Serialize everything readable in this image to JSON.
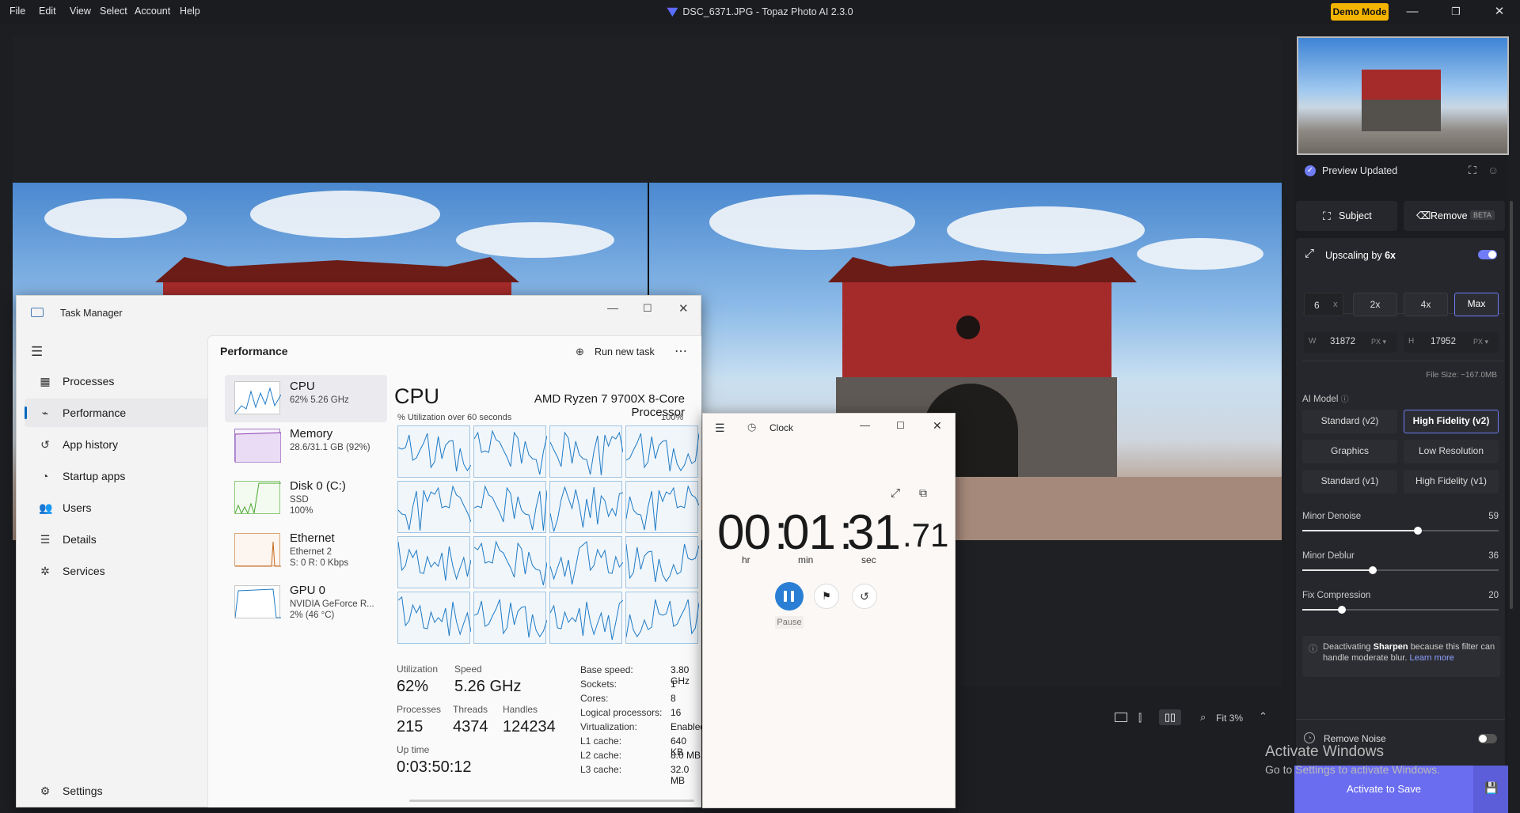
{
  "menu": [
    "File",
    "Edit",
    "View",
    "Select",
    "Account",
    "Help"
  ],
  "app_title": "DSC_6371.JPG - Topaz Photo AI 2.3.0",
  "demo_badge": "Demo Mode",
  "colors": {
    "accent": "#6f7cf5",
    "demo": "#f5b400",
    "tm_accent": "#0067c0",
    "clock_accent": "#2a7fd4"
  },
  "panel": {
    "preview_status": "Preview Updated",
    "subject_btn": "Subject",
    "remove_btn": "Remove",
    "beta": "BETA",
    "upscaling_label": "Upscaling by",
    "upscaling_value": "6x",
    "upscaling_on": true,
    "scale_input": "6",
    "scale_x": "x",
    "scale_opts": [
      "2x",
      "4x",
      "Max"
    ],
    "scale_selected": "Max",
    "w_label": "W",
    "w_value": "31872",
    "h_label": "H",
    "h_value": "17952",
    "unit": "PX",
    "file_size": "File Size: ~167.0MB",
    "ai_model_label": "AI Model",
    "models": [
      "Standard (v2)",
      "High Fidelity (v2)",
      "Graphics",
      "Low Resolution",
      "Standard (v1)",
      "High Fidelity (v1)"
    ],
    "model_selected": "High Fidelity (v2)",
    "sliders": [
      {
        "label": "Minor Denoise",
        "value": "59",
        "fraction": 0.59
      },
      {
        "label": "Minor Deblur",
        "value": "36",
        "fraction": 0.36
      },
      {
        "label": "Fix Compression",
        "value": "20",
        "fraction": 0.2
      }
    ],
    "notice_pre": "Deactivating",
    "notice_bold": "Sharpen",
    "notice_post": "because this filter can handle moderate blur.",
    "notice_link": "Learn more",
    "remove_noise": "Remove Noise",
    "remove_noise_on": false,
    "activate_btn": "Activate to Save",
    "zoom_label": "Fit 3%"
  },
  "watermark": {
    "title": "Activate Windows",
    "sub": "Go to Settings to activate Windows."
  },
  "task_manager": {
    "title": "Task Manager",
    "section": "Performance",
    "run_task": "Run new task",
    "nav": [
      {
        "label": "Processes",
        "icon": "grid-icon"
      },
      {
        "label": "Performance",
        "icon": "pulse-icon"
      },
      {
        "label": "App history",
        "icon": "history-icon"
      },
      {
        "label": "Startup apps",
        "icon": "speedometer-icon"
      },
      {
        "label": "Users",
        "icon": "users-icon"
      },
      {
        "label": "Details",
        "icon": "list-icon"
      },
      {
        "label": "Services",
        "icon": "puzzle-icon"
      }
    ],
    "settings": "Settings",
    "resources": [
      {
        "name": "CPU",
        "s1": "62%  5.26 GHz",
        "s2": ""
      },
      {
        "name": "Memory",
        "s1": "28.6/31.1 GB (92%)",
        "s2": ""
      },
      {
        "name": "Disk 0 (C:)",
        "s1": "SSD",
        "s2": "100%"
      },
      {
        "name": "Ethernet",
        "s1": "Ethernet 2",
        "s2": "S: 0 R: 0 Kbps"
      },
      {
        "name": "GPU 0",
        "s1": "NVIDIA GeForce R...",
        "s2": "2% (46 °C)"
      }
    ],
    "cpu_title": "CPU",
    "cpu_model": "AMD Ryzen 7 9700X 8-Core Processor",
    "util_caption": "% Utilization over 60 seconds",
    "util_max": "100%",
    "stats": {
      "utilization_label": "Utilization",
      "utilization": "62%",
      "speed_label": "Speed",
      "speed": "5.26 GHz",
      "processes_label": "Processes",
      "processes": "215",
      "threads_label": "Threads",
      "threads": "4374",
      "handles_label": "Handles",
      "handles": "124234",
      "uptime_label": "Up time",
      "uptime": "0:03:50:12"
    },
    "specs": [
      {
        "k": "Base speed:",
        "v": "3.80 GHz"
      },
      {
        "k": "Sockets:",
        "v": "1"
      },
      {
        "k": "Cores:",
        "v": "8"
      },
      {
        "k": "Logical processors:",
        "v": "16"
      },
      {
        "k": "Virtualization:",
        "v": "Enabled"
      },
      {
        "k": "L1 cache:",
        "v": "640 KB"
      },
      {
        "k": "L2 cache:",
        "v": "8.0 MB"
      },
      {
        "k": "L3 cache:",
        "v": "32.0 MB"
      }
    ]
  },
  "clock": {
    "title": "Clock",
    "hours": "00",
    "minutes": "01",
    "seconds": "31",
    "fraction": ".71",
    "hr": "hr",
    "min": "min",
    "sec": "sec",
    "pause": "Pause"
  }
}
